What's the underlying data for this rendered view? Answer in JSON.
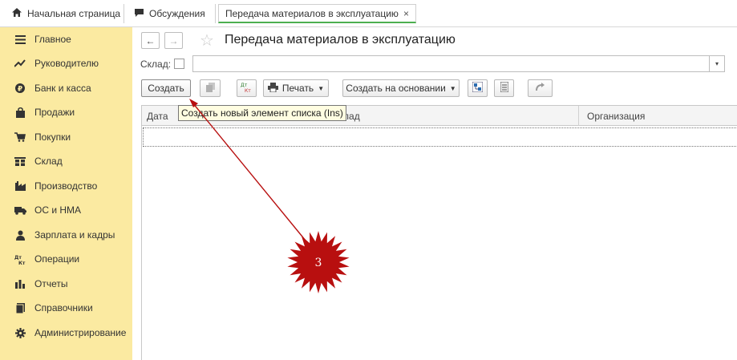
{
  "tabs": {
    "home_label": "Начальная страница",
    "discussions_label": "Обсуждения",
    "current_label": "Передача материалов в эксплуатацию",
    "close_glyph": "×"
  },
  "sidebar": {
    "background": "#fbeaa1",
    "items": [
      {
        "label": "Главное",
        "icon": "menu-icon"
      },
      {
        "label": "Руководителю",
        "icon": "trend-icon"
      },
      {
        "label": "Банк и касса",
        "icon": "money-icon"
      },
      {
        "label": "Продажи",
        "icon": "bag-icon"
      },
      {
        "label": "Покупки",
        "icon": "cart-icon"
      },
      {
        "label": "Склад",
        "icon": "warehouse-icon"
      },
      {
        "label": "Производство",
        "icon": "factory-icon"
      },
      {
        "label": "ОС и НМА",
        "icon": "truck-icon"
      },
      {
        "label": "Зарплата и кадры",
        "icon": "person-icon"
      },
      {
        "label": "Операции",
        "icon": "dt-kt-icon"
      },
      {
        "label": "Отчеты",
        "icon": "bar-chart-icon"
      },
      {
        "label": "Справочники",
        "icon": "book-icon"
      },
      {
        "label": "Администрирование",
        "icon": "gear-icon"
      }
    ]
  },
  "main": {
    "title": "Передача материалов в эксплуатацию",
    "back_glyph": "←",
    "forward_glyph": "→",
    "star_glyph": "☆",
    "warehouse_filter": {
      "label": "Склад:",
      "checked": false,
      "value": ""
    },
    "toolbar": {
      "create_label": "Создать",
      "print_label": "Печать",
      "create_based_label": "Создать на основании",
      "dtkt_top": "Дт",
      "dtkt_bottom": "Кт"
    },
    "tooltip": "Создать новый элемент списка (Ins)",
    "table": {
      "columns": [
        "Дата",
        "Склад",
        "Организация"
      ],
      "rows": []
    }
  },
  "annotation": {
    "number": "3",
    "color": "#b80f0f"
  }
}
